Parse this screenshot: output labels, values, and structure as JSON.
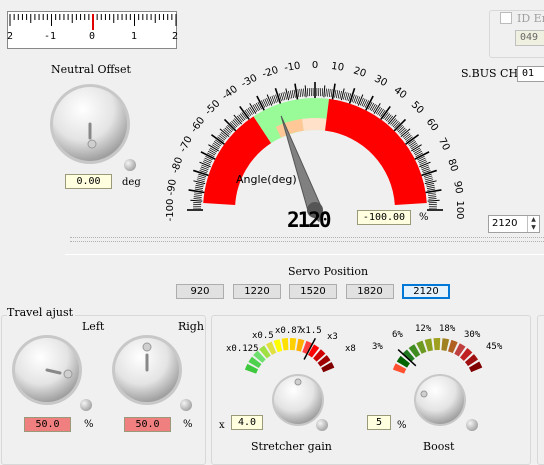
{
  "ruler": {
    "ticks": [
      "2",
      "-1",
      "0",
      "1",
      "2"
    ]
  },
  "neutral_offset": {
    "title": "Neutral Offset",
    "value": "0.00",
    "unit": "deg"
  },
  "top_right": {
    "id_label": "ID Er",
    "id_value": "049",
    "sbus_label": "S.BUS CH",
    "sbus_value": "01"
  },
  "gauge": {
    "scale_min": -100,
    "scale_max": 100,
    "major_labels": [
      "-100",
      "-90",
      "-80",
      "-70",
      "-60",
      "-50",
      "-40",
      "-30",
      "-20",
      "-10",
      "0",
      "10",
      "20",
      "30",
      "40",
      "50",
      "60",
      "70",
      "80",
      "90",
      "100"
    ],
    "title": "Angle(deg)",
    "needle_value": -22,
    "digital_readout": "2120",
    "percent_value": "-100.00",
    "percent_unit": "%",
    "colors": {
      "red": "#ff0000",
      "green": "#98fb98",
      "orange": "#ffc896",
      "peach": "#ffe0c8"
    }
  },
  "spin_value": "2120",
  "servo_position": {
    "title": "Servo Position",
    "buttons": [
      "920",
      "1220",
      "1520",
      "1820",
      "2120"
    ],
    "selected": 4
  },
  "travel_adjust": {
    "title": "Travel ajust",
    "left_label": "Left",
    "right_label": "Righ",
    "left_value": "50.0",
    "right_value": "50.0",
    "unit": "%"
  },
  "stretcher": {
    "scale_labels": [
      "x0.125",
      "x0.5",
      "x0.87",
      "x1.5",
      "x3",
      "x8"
    ],
    "prefix": "x",
    "value": "4.0",
    "title": "Stretcher gain"
  },
  "boost": {
    "scale_labels": [
      "3%",
      "6%",
      "12%",
      "18%",
      "30%",
      "45%"
    ],
    "value": "5",
    "unit": "%",
    "title": "Boost"
  }
}
